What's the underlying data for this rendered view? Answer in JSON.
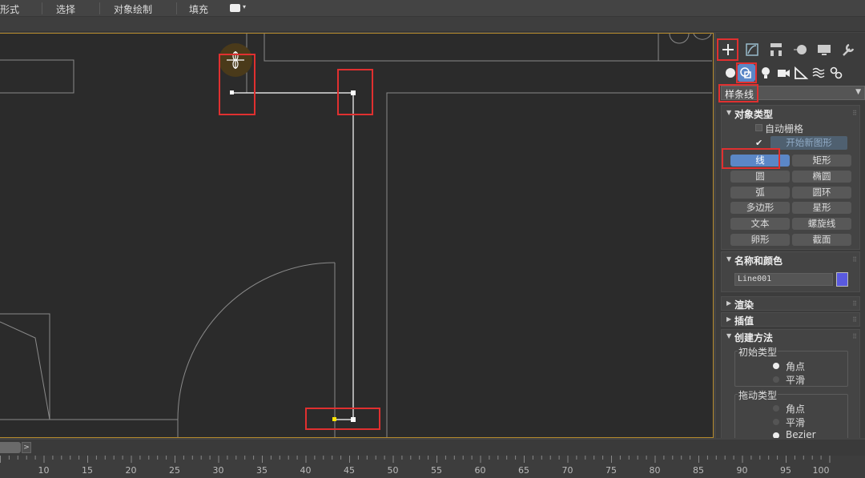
{
  "toolbar": {
    "items": [
      "形式",
      "选择",
      "对象绘制",
      "填充"
    ]
  },
  "viewport": {
    "line_color": "#ffffff",
    "geometry_color": "#8a8a8a",
    "highlight_color": "#e03030",
    "vertex_yellow": "#ffe400"
  },
  "panel": {
    "tabs": [
      "create-icon",
      "modify-icon",
      "hierarchy-icon",
      "motion-icon",
      "display-icon",
      "utilities-icon"
    ],
    "categories": [
      "geometry-icon",
      "shapes-icon",
      "lights-icon",
      "cameras-icon",
      "helpers-icon",
      "spacewarps-icon",
      "systems-icon"
    ],
    "dropdown_value": "样条线",
    "object_type": {
      "title": "对象类型",
      "autogrid": "自动栅格",
      "start_new_shape": "开始新图形",
      "buttons": [
        [
          "线",
          "矩形"
        ],
        [
          "圆",
          "椭圆"
        ],
        [
          "弧",
          "圆环"
        ],
        [
          "多边形",
          "星形"
        ],
        [
          "文本",
          "螺旋线"
        ],
        [
          "卵形",
          "截面"
        ]
      ]
    },
    "name_color": {
      "title": "名称和颜色",
      "name": "Line001",
      "color": "#5a5ae0"
    },
    "render_title": "渲染",
    "interp_title": "插值",
    "creation": {
      "title": "创建方法",
      "initial_type": "初始类型",
      "drag_type": "拖动类型",
      "corner": "角点",
      "smooth": "平滑",
      "bezier": "Bezier"
    }
  },
  "timeline": {
    "ticks": [
      "10",
      "15",
      "20",
      "25",
      "30",
      "35",
      "40",
      "45",
      "50",
      "55",
      "60",
      "65",
      "70",
      "75",
      "80",
      "85",
      "90",
      "95",
      "100"
    ]
  }
}
